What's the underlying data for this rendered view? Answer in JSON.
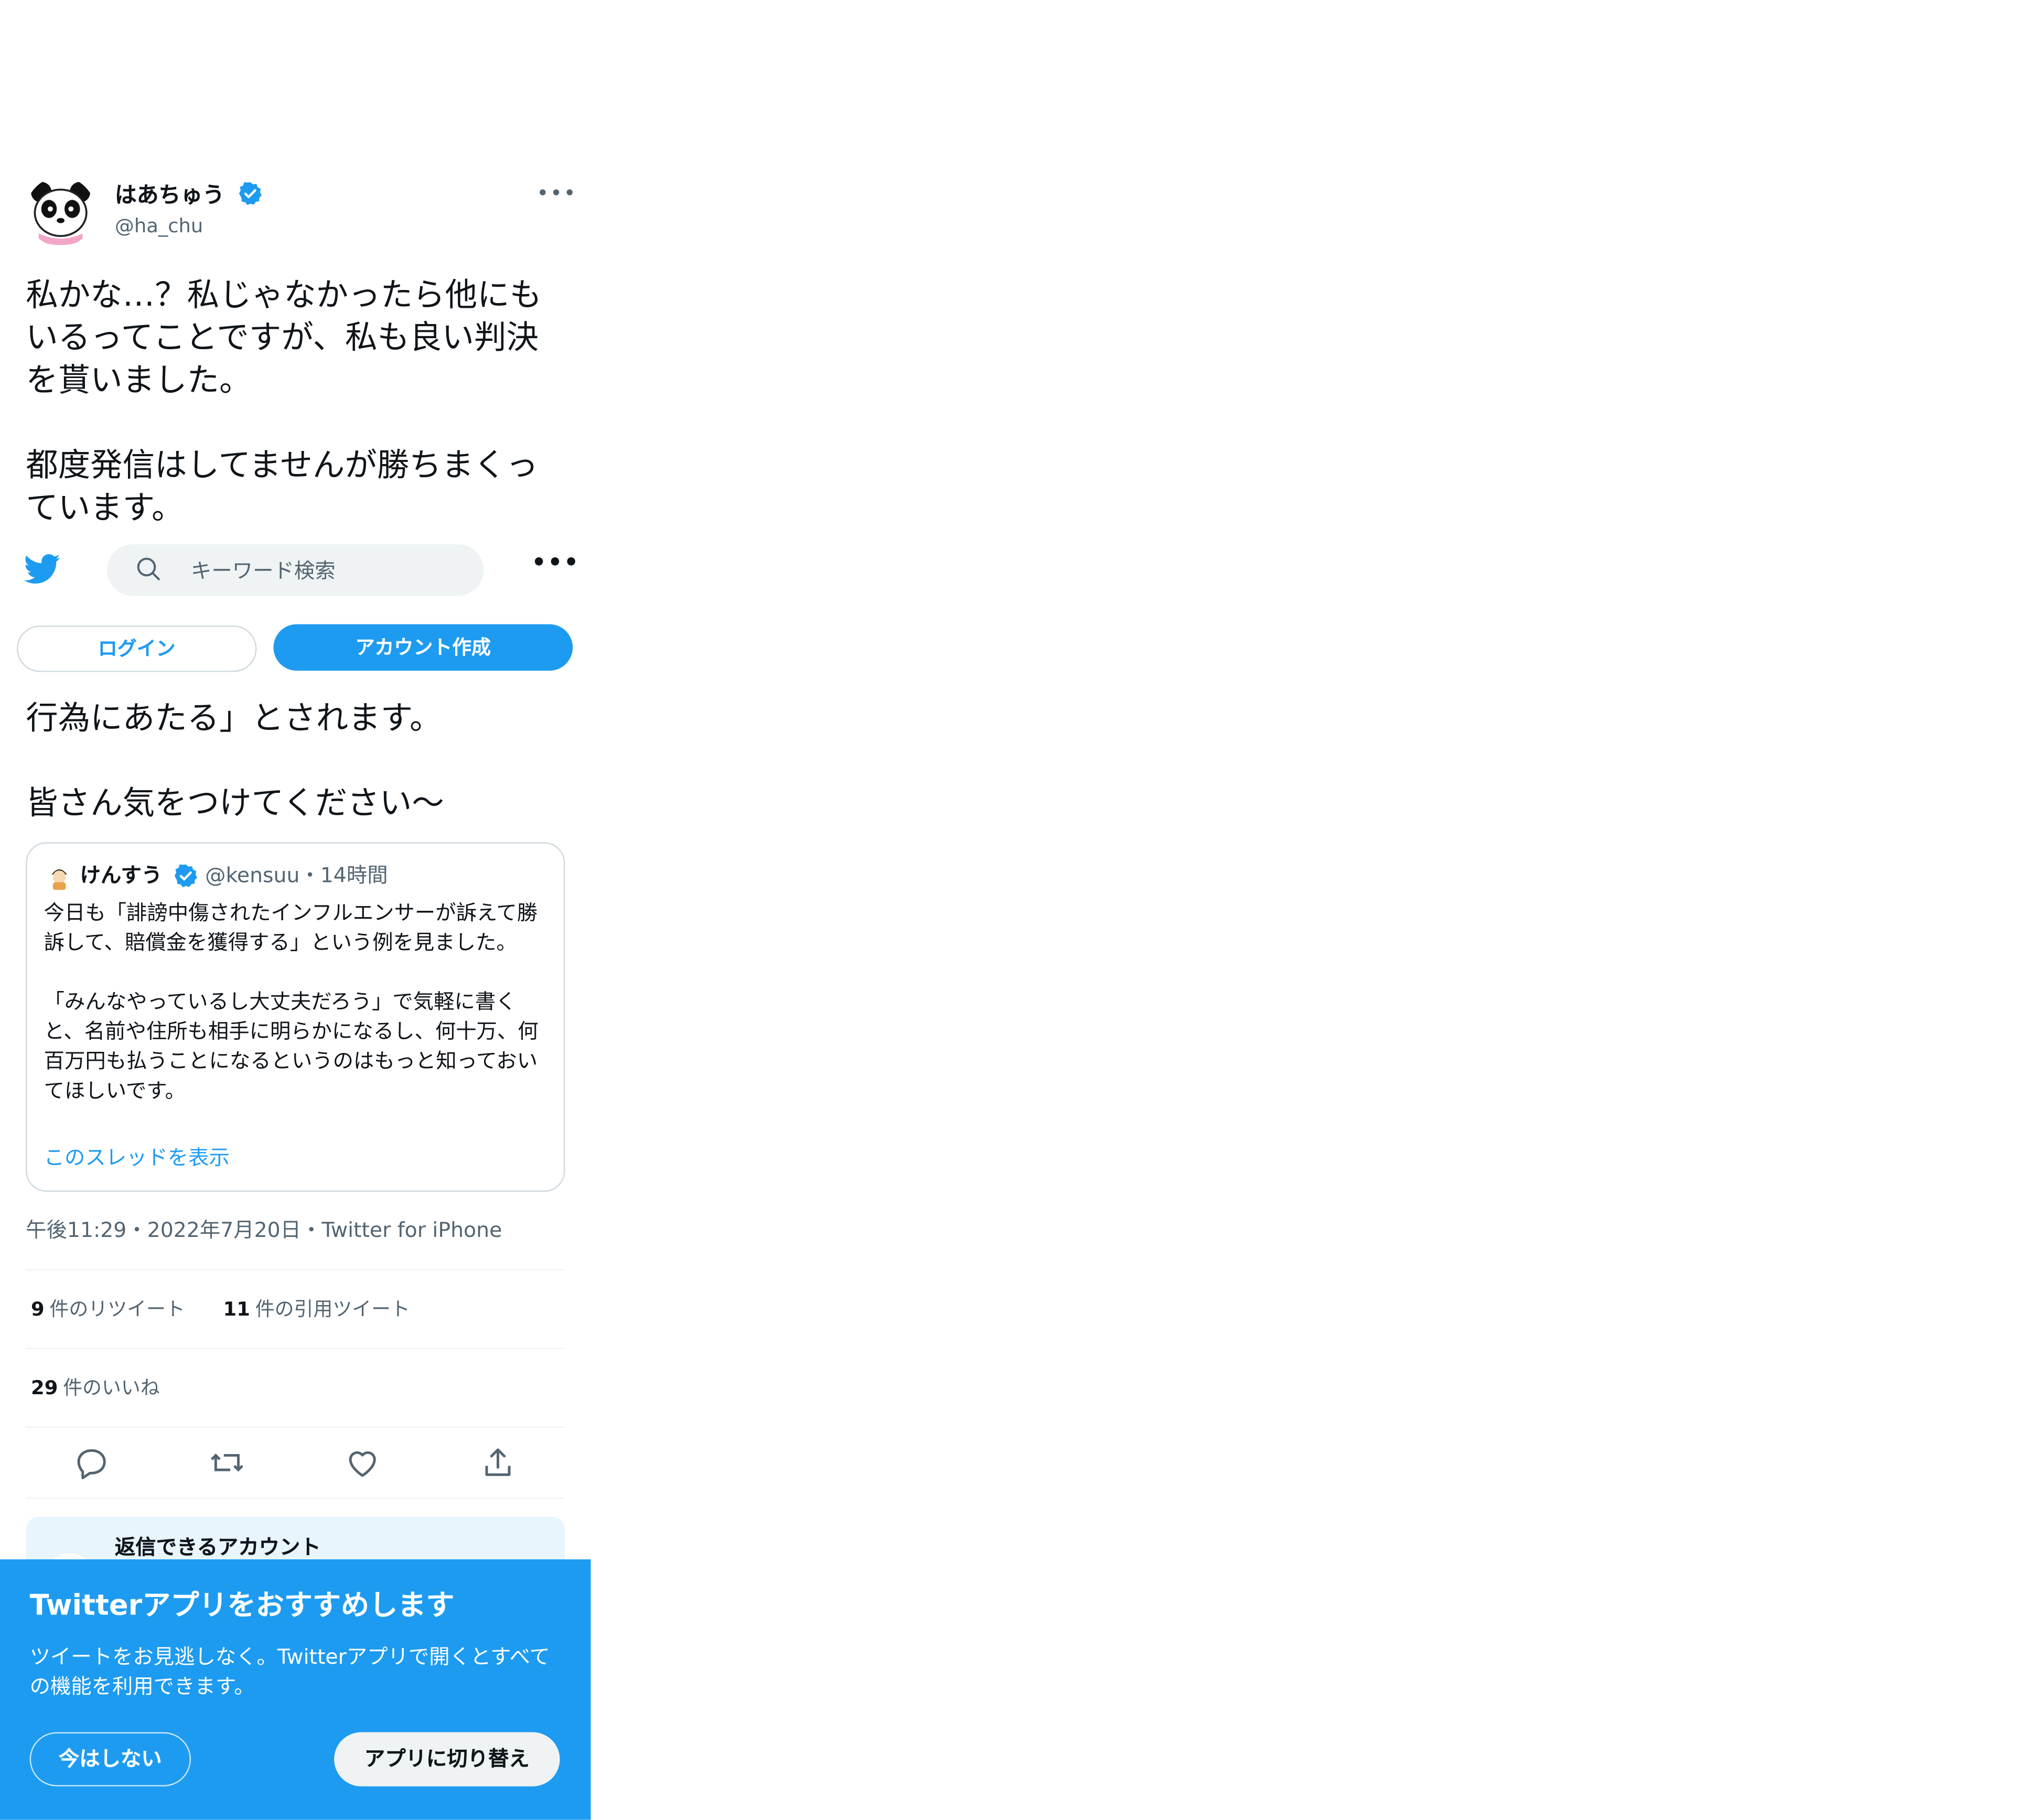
{
  "tweet": {
    "author_name": "はあちゅう",
    "author_handle": "@ha_chu",
    "body": "私かな…？私じゃなかったら他にもいるってことですが、私も良い判決を貰いました。\n\n都度発信はしてませんが勝ちまくっています。",
    "body_tail": "行為にあたる」とされます。\n\n皆さん気をつけてください〜",
    "timestamp": "午後11:29・2022年7月20日・Twitter for iPhone"
  },
  "nav": {
    "search_placeholder": "キーワード検索",
    "login_label": "ログイン",
    "signup_label": "アカウント作成"
  },
  "quote": {
    "name": "けんすう",
    "handle_time": "@kensuu・14時間",
    "text": "今日も「誹謗中傷されたインフルエンサーが訴えて勝訴して、賠償金を獲得する」という例を見ました。\n\n「みんなやっているし大丈夫だろう」で気軽に書くと、名前や住所も相手に明らかになるし、何十万、何百万円も払うことになるというのはもっと知っておいてほしいです。",
    "thread_link": "このスレッドを表示"
  },
  "stats": {
    "retweets_count": "9",
    "retweets_label": "件のリツイート",
    "quotes_count": "11",
    "quotes_label": "件の引用ツイート",
    "likes_count": "29",
    "likes_label": "件のいいね"
  },
  "actions": [
    "reply-icon",
    "retweet-icon",
    "like-icon",
    "share-icon"
  ],
  "reply_notice": {
    "title": "返信できるアカウント"
  },
  "app_banner": {
    "title": "Twitterアプリをおすすめします",
    "text": "ツイートをお見逃しなく。Twitterアプリで開くとすべての機能を利用できます。",
    "not_now_label": "今はしない",
    "switch_label": "アプリに切り替え"
  },
  "colors": {
    "accent": "#1d9bf0",
    "text": "#0f1419",
    "muted": "#536471",
    "border": "#cfd9de"
  }
}
